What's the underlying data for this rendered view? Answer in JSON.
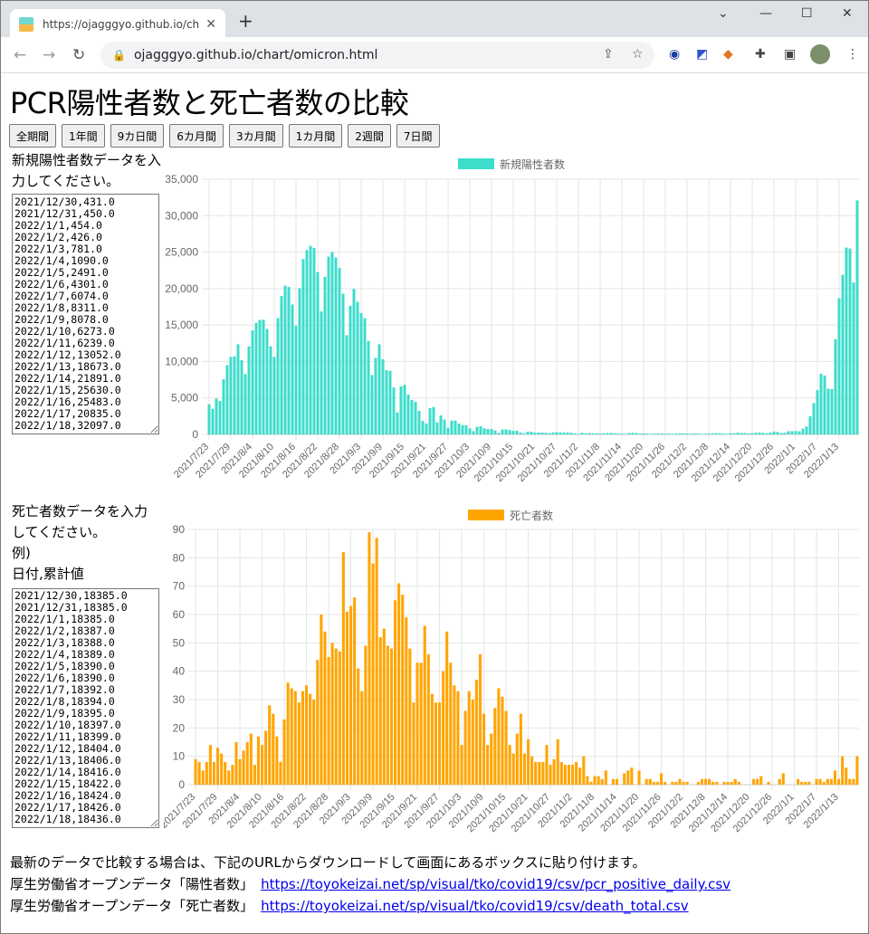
{
  "browser": {
    "tab_title": "https://ojagggyo.github.io/chart/",
    "url": "ojagggyo.github.io/chart/omicron.html"
  },
  "page": {
    "title": "PCR陽性者数と死亡者数の比較"
  },
  "buttons": [
    "全期間",
    "1年間",
    "9カ日間",
    "6カ月間",
    "3カ月間",
    "1カ月間",
    "2週間",
    "7日間"
  ],
  "positive_input": {
    "label": "新規陽性者数データを入力してください。",
    "value": "2021/12/30,431.0\n2021/12/31,450.0\n2022/1/1,454.0\n2022/1/2,426.0\n2022/1/3,781.0\n2022/1/4,1090.0\n2022/1/5,2491.0\n2022/1/6,4301.0\n2022/1/7,6074.0\n2022/1/8,8311.0\n2022/1/9,8078.0\n2022/1/10,6273.0\n2022/1/11,6239.0\n2022/1/12,13052.0\n2022/1/13,18673.0\n2022/1/14,21891.0\n2022/1/15,25630.0\n2022/1/16,25483.0\n2022/1/17,20835.0\n2022/1/18,32097.0"
  },
  "death_input": {
    "label_line1": "死亡者数データを入力してください。",
    "label_line2": "例)",
    "label_line3": "日付,累計値",
    "value": "2021/12/30,18385.0\n2021/12/31,18385.0\n2022/1/1,18385.0\n2022/1/2,18387.0\n2022/1/3,18388.0\n2022/1/4,18389.0\n2022/1/5,18390.0\n2022/1/6,18390.0\n2022/1/7,18392.0\n2022/1/8,18394.0\n2022/1/9,18395.0\n2022/1/10,18397.0\n2022/1/11,18399.0\n2022/1/12,18404.0\n2022/1/13,18406.0\n2022/1/14,18416.0\n2022/1/15,18422.0\n2022/1/16,18424.0\n2022/1/17,18426.0\n2022/1/18,18436.0"
  },
  "footer": {
    "note": "最新のデータで比較する場合は、下記のURLからダウンロードして画面にあるボックスに貼り付けます。",
    "source1_label": "厚生労働省オープンデータ「陽性者数」",
    "source1_url": "https://toyokeizai.net/sp/visual/tko/covid19/csv/pcr_positive_daily.csv",
    "source2_label": "厚生労働省オープンデータ「死亡者数」",
    "source2_url": "https://toyokeizai.net/sp/visual/tko/covid19/csv/death_total.csv"
  },
  "chart_data": [
    {
      "type": "bar",
      "legend": "新規陽性者数",
      "legend_placement": "top",
      "color": "#3ddccb",
      "ylim": [
        0,
        35000
      ],
      "yticks": [
        0,
        5000,
        10000,
        15000,
        20000,
        25000,
        30000,
        35000
      ],
      "ytick_labels": [
        "0",
        "5,000",
        "10,000",
        "15,000",
        "20,000",
        "25,000",
        "30,000",
        "35,000"
      ],
      "grid": true,
      "xtick_labels": [
        "2021/7/23",
        "2021/7/29",
        "2021/8/4",
        "2021/8/10",
        "2021/8/16",
        "2021/8/22",
        "2021/8/28",
        "2021/9/3",
        "2021/9/9",
        "2021/9/15",
        "2021/9/21",
        "2021/9/27",
        "2021/10/3",
        "2021/10/9",
        "2021/10/15",
        "2021/10/21",
        "2021/10/27",
        "2021/11/2",
        "2021/11/8",
        "2021/11/14",
        "2021/11/20",
        "2021/11/26",
        "2021/12/2",
        "2021/12/8",
        "2021/12/14",
        "2021/12/20",
        "2021/12/26",
        "2022/1/1",
        "2022/1/7",
        "2022/1/13"
      ],
      "values": [
        4130,
        3510,
        4920,
        4590,
        7560,
        9500,
        10620,
        10700,
        12360,
        10170,
        8260,
        12070,
        14260,
        15290,
        15700,
        15740,
        14460,
        12070,
        10620,
        15950,
        18970,
        20410,
        20210,
        17810,
        14920,
        20040,
        24050,
        25290,
        25870,
        25580,
        22270,
        16860,
        21610,
        24380,
        25000,
        24260,
        22810,
        19300,
        13600,
        17640,
        19960,
        18180,
        16650,
        15950,
        12810,
        8140,
        10500,
        12360,
        10300,
        8810,
        8730,
        6450,
        3020,
        6580,
        6820,
        5460,
        4720,
        4470,
        3230,
        1860,
        1490,
        3600,
        3760,
        1650,
        2610,
        2030,
        910,
        1900,
        1900,
        1490,
        1280,
        1240,
        830,
        450,
        1030,
        1120,
        830,
        740,
        740,
        540,
        210,
        660,
        700,
        620,
        500,
        500,
        250,
        120,
        370,
        370,
        250,
        250,
        250,
        230,
        180,
        260,
        310,
        290,
        270,
        260,
        230,
        150,
        85,
        230,
        160,
        190,
        160,
        160,
        110,
        160,
        190,
        200,
        160,
        140,
        130,
        80,
        190,
        230,
        190,
        140,
        150,
        120,
        80,
        120,
        150,
        130,
        110,
        120,
        80,
        140,
        160,
        150,
        130,
        110,
        140,
        130,
        80,
        100,
        140,
        160,
        180,
        160,
        140,
        90,
        170,
        180,
        230,
        200,
        200,
        130,
        180,
        250,
        260,
        220,
        170,
        240,
        390,
        340,
        190,
        230,
        431,
        450,
        454,
        426,
        781,
        1090,
        2491,
        4301,
        6074,
        8311,
        8078,
        6273,
        6239,
        13052,
        18673,
        21891,
        25630,
        25483,
        20835,
        32097
      ]
    },
    {
      "type": "bar",
      "legend": "死亡者数",
      "legend_placement": "top",
      "color": "#ffa500",
      "ylim": [
        0,
        90
      ],
      "yticks": [
        0,
        10,
        20,
        30,
        40,
        50,
        60,
        70,
        80,
        90
      ],
      "ytick_labels": [
        "0",
        "10",
        "20",
        "30",
        "40",
        "50",
        "60",
        "70",
        "80",
        "90"
      ],
      "grid": true,
      "xtick_labels": [
        "2021/7/23",
        "2021/7/29",
        "2021/8/4",
        "2021/8/10",
        "2021/8/16",
        "2021/8/22",
        "2021/8/28",
        "2021/9/3",
        "2021/9/9",
        "2021/9/15",
        "2021/9/21",
        "2021/9/27",
        "2021/10/3",
        "2021/10/9",
        "2021/10/15",
        "2021/10/21",
        "2021/10/27",
        "2021/11/2",
        "2021/11/8",
        "2021/11/14",
        "2021/11/20",
        "2021/11/26",
        "2021/12/2",
        "2021/12/8",
        "2021/12/14",
        "2021/12/20",
        "2021/12/26",
        "2022/1/1",
        "2022/1/7",
        "2022/1/13"
      ],
      "values": [
        9,
        8,
        5,
        8,
        14,
        8,
        13,
        11,
        8,
        5,
        7,
        15,
        9,
        12,
        15,
        18,
        7,
        17,
        14,
        19,
        28,
        25,
        17,
        8,
        23,
        36,
        34,
        33,
        29,
        33,
        35,
        32,
        30,
        44,
        60,
        54,
        45,
        50,
        48,
        47,
        82,
        61,
        63,
        66,
        41,
        33,
        49,
        89,
        78,
        87,
        52,
        55,
        49,
        48,
        65,
        71,
        67,
        59,
        48,
        29,
        43,
        43,
        56,
        46,
        32,
        29,
        29,
        40,
        54,
        43,
        35,
        33,
        14,
        26,
        33,
        30,
        37,
        46,
        25,
        14,
        18,
        27,
        34,
        31,
        26,
        14,
        11,
        18,
        25,
        11,
        16,
        10,
        8,
        8,
        8,
        14,
        7,
        9,
        16,
        8,
        7,
        7,
        7,
        8,
        6,
        10,
        3,
        1,
        3,
        3,
        2,
        5,
        0,
        2,
        2,
        0,
        4,
        5,
        6,
        0,
        5,
        0,
        2,
        2,
        1,
        1,
        4,
        1,
        0,
        1,
        1,
        2,
        1,
        1,
        0,
        0,
        1,
        2,
        2,
        2,
        1,
        1,
        0,
        1,
        1,
        1,
        2,
        1,
        0,
        0,
        0,
        2,
        2,
        3,
        0,
        1,
        0,
        0,
        2,
        4,
        0,
        0,
        0,
        2,
        1,
        1,
        1,
        0,
        2,
        2,
        1,
        2,
        2,
        5,
        2,
        10,
        6,
        2,
        2,
        10
      ]
    }
  ]
}
